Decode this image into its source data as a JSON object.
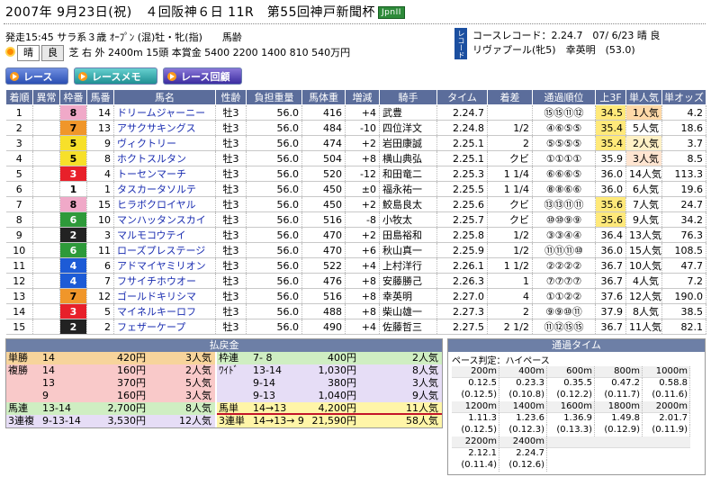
{
  "header": {
    "title": "2007年 9月23日(祝)　４回阪神６日 11R　第55回神戸新聞杯",
    "grade": "JpnII"
  },
  "race_info": {
    "line1": "発走15:45 サラ系３歳 ｵｰﾌﾟﾝ (混)牡・牝(指)　　馬齢",
    "weather": "晴",
    "going": "良",
    "line2": "芝 右 外 2400m 15頭 本賞金 5400 2200 1400 810 540万円"
  },
  "record": {
    "tag": "レコード",
    "line1": "コースレコード：2.24.7　07/ 6/23 晴 良",
    "line2": "リヴァプール(牝5)　幸英明　(53.0)"
  },
  "buttons": {
    "race": "レース",
    "memo": "レースメモ",
    "replay": "レース回顧"
  },
  "table": {
    "headers": [
      "着順",
      "異常",
      "枠番",
      "馬番",
      "馬名",
      "性齢",
      "負担重量",
      "馬体重",
      "増減",
      "騎手",
      "タイム",
      "着差",
      "通過順位",
      "上3F",
      "単人気",
      "単オッズ"
    ],
    "gate_colors": {
      "1": "#ffffff",
      "2": "#222222",
      "3": "#e8202a",
      "4": "#1d5bd6",
      "5": "#f7e02a",
      "6": "#2e9a3a",
      "7": "#f0962a",
      "8": "#f0a9c8"
    },
    "rows": [
      {
        "rank": "1",
        "abn": "",
        "gate": "8",
        "num": "14",
        "name": "ドリームジャーニー",
        "sex": "牡3",
        "wt": "56.0",
        "bw": "416",
        "diff": "+4",
        "jockey": "武豊",
        "time": "2.24.7",
        "margin": "",
        "pass": "⑮⑮⑪⑫",
        "f3": "34.5",
        "pop": "1人気",
        "odds": "4.2"
      },
      {
        "rank": "2",
        "abn": "",
        "gate": "7",
        "num": "13",
        "name": "アサクサキングス",
        "sex": "牡3",
        "wt": "56.0",
        "bw": "484",
        "diff": "-10",
        "jockey": "四位洋文",
        "time": "2.24.8",
        "margin": "1/2",
        "pass": "④⑥⑤⑤",
        "f3": "35.4",
        "pop": "5人気",
        "odds": "18.6"
      },
      {
        "rank": "3",
        "abn": "",
        "gate": "5",
        "num": "9",
        "name": "ヴィクトリー",
        "sex": "牡3",
        "wt": "56.0",
        "bw": "474",
        "diff": "+2",
        "jockey": "岩田康誠",
        "time": "2.25.1",
        "margin": "2",
        "pass": "⑤⑤⑤⑤",
        "f3": "35.4",
        "pop": "2人気",
        "odds": "3.7"
      },
      {
        "rank": "4",
        "abn": "",
        "gate": "5",
        "num": "8",
        "name": "ホクトスルタン",
        "sex": "牡3",
        "wt": "56.0",
        "bw": "504",
        "diff": "+8",
        "jockey": "横山典弘",
        "time": "2.25.1",
        "margin": "クビ",
        "pass": "①①①①",
        "f3": "35.9",
        "pop": "3人気",
        "odds": "8.5"
      },
      {
        "rank": "5",
        "abn": "",
        "gate": "3",
        "num": "4",
        "name": "トーセンマーチ",
        "sex": "牡3",
        "wt": "56.0",
        "bw": "520",
        "diff": "-12",
        "jockey": "和田竜二",
        "time": "2.25.3",
        "margin": "1 1/4",
        "pass": "⑥⑥⑥⑤",
        "f3": "36.0",
        "pop": "14人気",
        "odds": "113.3"
      },
      {
        "rank": "6",
        "abn": "",
        "gate": "1",
        "num": "1",
        "name": "タスカータソルテ",
        "sex": "牡3",
        "wt": "56.0",
        "bw": "450",
        "diff": "±0",
        "jockey": "福永祐一",
        "time": "2.25.5",
        "margin": "1 1/4",
        "pass": "⑧⑧⑥⑥",
        "f3": "36.0",
        "pop": "6人気",
        "odds": "19.6"
      },
      {
        "rank": "7",
        "abn": "",
        "gate": "8",
        "num": "15",
        "name": "ヒラボクロイヤル",
        "sex": "牡3",
        "wt": "56.0",
        "bw": "450",
        "diff": "+2",
        "jockey": "鮫島良太",
        "time": "2.25.6",
        "margin": "クビ",
        "pass": "⑬⑬⑪⑪",
        "f3": "35.6",
        "pop": "7人気",
        "odds": "24.7"
      },
      {
        "rank": "8",
        "abn": "",
        "gate": "6",
        "num": "10",
        "name": "マンハッタンスカイ",
        "sex": "牡3",
        "wt": "56.0",
        "bw": "516",
        "diff": "-8",
        "jockey": "小牧太",
        "time": "2.25.7",
        "margin": "クビ",
        "pass": "⑩⑩⑨⑨",
        "f3": "35.6",
        "pop": "9人気",
        "odds": "34.2"
      },
      {
        "rank": "9",
        "abn": "",
        "gate": "2",
        "num": "3",
        "name": "マルモコウテイ",
        "sex": "牡3",
        "wt": "56.0",
        "bw": "470",
        "diff": "+2",
        "jockey": "田島裕和",
        "time": "2.25.8",
        "margin": "1/2",
        "pass": "③③④④",
        "f3": "36.4",
        "pop": "13人気",
        "odds": "76.3"
      },
      {
        "rank": "10",
        "abn": "",
        "gate": "6",
        "num": "11",
        "name": "ローズプレステージ",
        "sex": "牡3",
        "wt": "56.0",
        "bw": "470",
        "diff": "+6",
        "jockey": "秋山真一",
        "time": "2.25.9",
        "margin": "1/2",
        "pass": "⑪⑪⑪⑩",
        "f3": "36.0",
        "pop": "15人気",
        "odds": "108.5"
      },
      {
        "rank": "11",
        "abn": "",
        "gate": "4",
        "num": "6",
        "name": "アドマイヤミリオン",
        "sex": "牡3",
        "wt": "56.0",
        "bw": "522",
        "diff": "+4",
        "jockey": "上村洋行",
        "time": "2.26.1",
        "margin": "1 1/2",
        "pass": "②②②②",
        "f3": "36.7",
        "pop": "10人気",
        "odds": "47.7"
      },
      {
        "rank": "12",
        "abn": "",
        "gate": "4",
        "num": "7",
        "name": "フサイチホウオー",
        "sex": "牡3",
        "wt": "56.0",
        "bw": "476",
        "diff": "+8",
        "jockey": "安藤勝己",
        "time": "2.26.3",
        "margin": "1",
        "pass": "⑦⑦⑦⑦",
        "f3": "36.7",
        "pop": "4人気",
        "odds": "7.2"
      },
      {
        "rank": "13",
        "abn": "",
        "gate": "7",
        "num": "12",
        "name": "ゴールドキリシマ",
        "sex": "牡3",
        "wt": "56.0",
        "bw": "516",
        "diff": "+8",
        "jockey": "幸英明",
        "time": "2.27.0",
        "margin": "4",
        "pass": "①①②②",
        "f3": "37.6",
        "pop": "12人気",
        "odds": "190.0"
      },
      {
        "rank": "14",
        "abn": "",
        "gate": "3",
        "num": "5",
        "name": "マイネルキーロフ",
        "sex": "牡3",
        "wt": "56.0",
        "bw": "488",
        "diff": "+8",
        "jockey": "柴山雄一",
        "time": "2.27.3",
        "margin": "2",
        "pass": "⑨⑨⑩⑪",
        "f3": "37.9",
        "pop": "8人気",
        "odds": "38.5"
      },
      {
        "rank": "15",
        "abn": "",
        "gate": "2",
        "num": "2",
        "name": "フェザーケープ",
        "sex": "牡3",
        "wt": "56.0",
        "bw": "490",
        "diff": "+4",
        "jockey": "佐藤哲三",
        "time": "2.27.5",
        "margin": "2 1/2",
        "pass": "⑪⑫⑮⑮",
        "f3": "36.7",
        "pop": "11人気",
        "odds": "82.1"
      }
    ]
  },
  "payout": {
    "title": "払戻金",
    "tansho": {
      "label": "単勝",
      "num": "14",
      "amount": "420円",
      "pop": "3人気"
    },
    "fukusho": {
      "label": "複勝",
      "rows": [
        {
          "num": "14",
          "amount": "160円",
          "pop": "2人気"
        },
        {
          "num": "13",
          "amount": "370円",
          "pop": "5人気"
        },
        {
          "num": "9",
          "amount": "160円",
          "pop": "3人気"
        }
      ]
    },
    "umaren": {
      "label": "馬連",
      "num": "13-14",
      "amount": "2,700円",
      "pop": "8人気"
    },
    "sanrenpuku": {
      "label": "3連複",
      "num": "9-13-14",
      "amount": "3,530円",
      "pop": "12人気"
    },
    "wakuren": {
      "label": "枠連",
      "num": "7- 8",
      "amount": "400円",
      "pop": "2人気"
    },
    "wide": {
      "label": "ﾜｲﾄﾞ",
      "rows": [
        {
          "num": "13-14",
          "amount": "1,030円",
          "pop": "8人気"
        },
        {
          "num": "9-14",
          "amount": "380円",
          "pop": "3人気"
        },
        {
          "num": "9-13",
          "amount": "1,040円",
          "pop": "9人気"
        }
      ]
    },
    "umatan": {
      "label": "馬単",
      "num": "14→13",
      "amount": "4,200円",
      "pop": "11人気"
    },
    "sanrentan": {
      "label": "3連単",
      "num": "14→13→ 9",
      "amount": "21,590円",
      "pop": "58人気"
    }
  },
  "times": {
    "title": "通過タイム",
    "pace": "ペース判定：ハイペース",
    "cells": [
      {
        "d": "200m",
        "t": "0.12.5",
        "s": "(0.12.5)"
      },
      {
        "d": "400m",
        "t": "0.23.3",
        "s": "(0.10.8)"
      },
      {
        "d": "600m",
        "t": "0.35.5",
        "s": "(0.12.2)"
      },
      {
        "d": "800m",
        "t": "0.47.2",
        "s": "(0.11.7)"
      },
      {
        "d": "1000m",
        "t": "0.58.8",
        "s": "(0.11.6)"
      },
      {
        "d": "1200m",
        "t": "1.11.3",
        "s": "(0.12.5)"
      },
      {
        "d": "1400m",
        "t": "1.23.6",
        "s": "(0.12.3)"
      },
      {
        "d": "1600m",
        "t": "1.36.9",
        "s": "(0.13.3)"
      },
      {
        "d": "1800m",
        "t": "1.49.8",
        "s": "(0.12.9)"
      },
      {
        "d": "2000m",
        "t": "2.01.7",
        "s": "(0.11.9)"
      },
      {
        "d": "2200m",
        "t": "2.12.1",
        "s": "(0.11.4)"
      },
      {
        "d": "2400m",
        "t": "2.24.7",
        "s": "(0.12.6)"
      }
    ]
  }
}
